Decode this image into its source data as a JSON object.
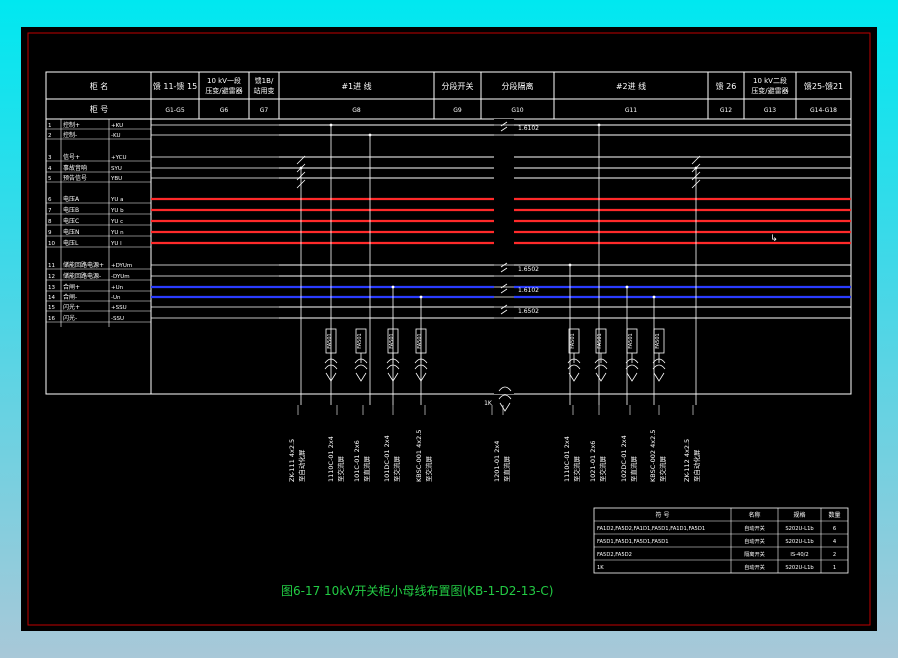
{
  "colors": {
    "background": "#000000",
    "frame": "#c00000",
    "lines": "#ffffff",
    "voltage_bus": "#ff2a2a",
    "dc_bus": "#2a3cff",
    "caption": "#22cc44",
    "outer": "#22e0ee"
  },
  "header": {
    "row1_title": "柜 名",
    "row2_title": "柜 号",
    "row1": [
      {
        "text": "馈 11-馈 15"
      },
      {
        "text": "10 kV一段",
        "text2": "压变/避雷器"
      },
      {
        "text": "馈1B/",
        "text2": "站用变"
      },
      {
        "text": "#1进 线"
      },
      {
        "text": "分段开关"
      },
      {
        "text": "分段隔离"
      },
      {
        "text": "#2进 线"
      },
      {
        "text": "馈 26"
      },
      {
        "text": "10 kV二段",
        "text2": "压变/避雷器"
      },
      {
        "text": "馈25-馈21"
      }
    ],
    "row2": [
      "G1-G5",
      "G6",
      "G7",
      "G8",
      "G9",
      "G10",
      "G11",
      "G12",
      "G13",
      "G14-G18"
    ]
  },
  "bus_rows": [
    {
      "num": "1",
      "name": "控制+",
      "code": "+KU"
    },
    {
      "num": "2",
      "name": "控制-",
      "code": "-KU"
    },
    {
      "num": "3",
      "name": "信号+",
      "code": "+YCU"
    },
    {
      "num": "4",
      "name": "事故音响",
      "code": "SYU"
    },
    {
      "num": "5",
      "name": "预告信号",
      "code": "YBU"
    },
    {
      "num": "6",
      "name": "电压A",
      "code": "YU a"
    },
    {
      "num": "7",
      "name": "电压B",
      "code": "YU b"
    },
    {
      "num": "8",
      "name": "电压C",
      "code": "YU c"
    },
    {
      "num": "9",
      "name": "电压N",
      "code": "YU n"
    },
    {
      "num": "10",
      "name": "电压L",
      "code": "YU l"
    },
    {
      "num": "11",
      "name": "储能回路电源+",
      "code": "+DYUm"
    },
    {
      "num": "12",
      "name": "储能回路电源-",
      "code": "-DYUm"
    },
    {
      "num": "13",
      "name": "合闸+",
      "code": "+Un"
    },
    {
      "num": "14",
      "name": "合闸-",
      "code": "-Un"
    },
    {
      "num": "15",
      "name": "闪光+",
      "code": "+SSU"
    },
    {
      "num": "16",
      "name": "闪光-",
      "code": "-SSU"
    }
  ],
  "breaker_labels": [
    "1.6102",
    "1.6502",
    "1.6102",
    "1.6502"
  ],
  "devices": [
    "FA501",
    "FA501",
    "FA501",
    "FA501",
    "FA501",
    "FA501",
    "FA501",
    "FA501"
  ],
  "cables": [
    {
      "id": "ZK-111 4x2.5",
      "dest": "至自动化屏"
    },
    {
      "id": "1110C-01 2x4",
      "dest": "至交流屏"
    },
    {
      "id": "101C-01 2x6",
      "dest": "至直流屏"
    },
    {
      "id": "101DC-01 2x4",
      "dest": "至交流屏"
    },
    {
      "id": "KBSC-001 4x2.5",
      "dest": "至交流屏"
    },
    {
      "id": "1K",
      "dest": ""
    },
    {
      "id": "1201-01 2x4",
      "dest": "至直流屏"
    },
    {
      "id": "1110C-01 2x4",
      "dest": "至交流屏"
    },
    {
      "id": "1021-01 2x6",
      "dest": "至交流屏"
    },
    {
      "id": "102DC-01 2x4",
      "dest": "至直流屏"
    },
    {
      "id": "KBSC-002 4x2.5",
      "dest": "至交流屏"
    },
    {
      "id": "ZK-112 4x2.5",
      "dest": "至自动化屏"
    }
  ],
  "legend_table": {
    "headers": [
      "符 号",
      "名称",
      "规格",
      "数量"
    ],
    "rows": [
      [
        "FA1D2,FA5D2,FA1D1,FA5D1,FA1D1,FA5D1",
        "自动开关",
        "S202U-L1b",
        "6"
      ],
      [
        "FA5D1,FA5D1,FA5D1,FA5D1",
        "自动开关",
        "S202U-L1b",
        "4"
      ],
      [
        "FA5D2,FA5D2",
        "隔离开关",
        "IS-40/2",
        "2"
      ],
      [
        "1K",
        "自动开关",
        "S202U-L1b",
        "1"
      ]
    ]
  },
  "caption": "图6-17  10kV开关柜小母线布置图(KB-1-D2-13-C)"
}
